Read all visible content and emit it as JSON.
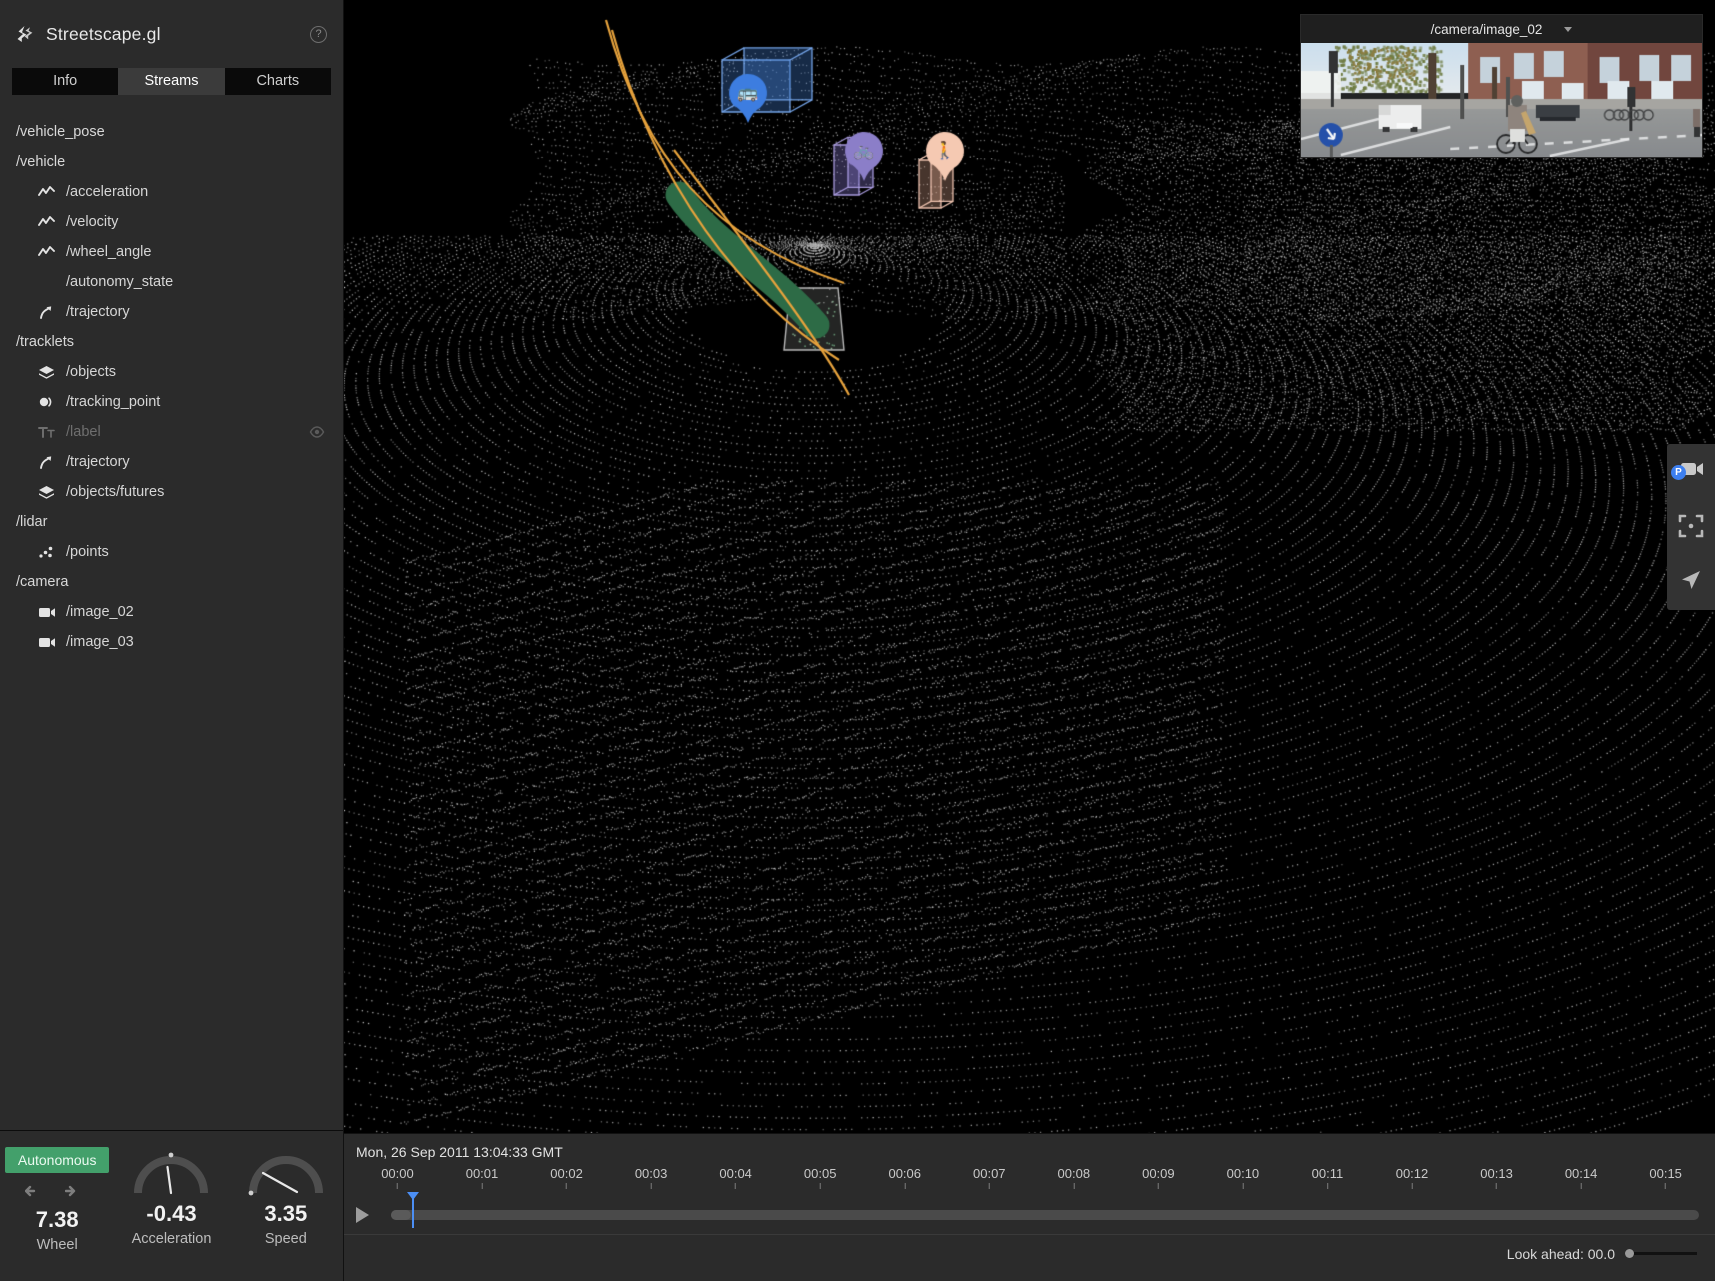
{
  "app": {
    "title": "Streetscape.gl",
    "logo_icon": "streetscape-logo-icon",
    "help_icon": "help-circle-icon"
  },
  "tabs": [
    {
      "label": "Info",
      "active": false
    },
    {
      "label": "Streams",
      "active": true
    },
    {
      "label": "Charts",
      "active": false
    }
  ],
  "streams": [
    {
      "label": "/vehicle_pose",
      "level": "group",
      "icon": null,
      "disabled": false
    },
    {
      "label": "/vehicle",
      "level": "group",
      "icon": null,
      "disabled": false
    },
    {
      "label": "/acceleration",
      "level": "child",
      "icon": "line-chart-icon",
      "disabled": false
    },
    {
      "label": "/velocity",
      "level": "child",
      "icon": "line-chart-icon",
      "disabled": false
    },
    {
      "label": "/wheel_angle",
      "level": "child",
      "icon": "line-chart-icon",
      "disabled": false
    },
    {
      "label": "/autonomy_state",
      "level": "child",
      "icon": null,
      "disabled": false
    },
    {
      "label": "/trajectory",
      "level": "child",
      "icon": "arrow-path-icon",
      "disabled": false
    },
    {
      "label": "/tracklets",
      "level": "group",
      "icon": null,
      "disabled": false
    },
    {
      "label": "/objects",
      "level": "child",
      "icon": "cube-icon",
      "disabled": false
    },
    {
      "label": "/tracking_point",
      "level": "child",
      "icon": "tracking-point-icon",
      "disabled": false
    },
    {
      "label": "/label",
      "level": "child",
      "icon": "text-icon",
      "disabled": true,
      "trailing_icon": "eye-off-icon"
    },
    {
      "label": "/trajectory",
      "level": "child",
      "icon": "arrow-path-icon",
      "disabled": false
    },
    {
      "label": "/objects/futures",
      "level": "child",
      "icon": "cube-icon",
      "disabled": false
    },
    {
      "label": "/lidar",
      "level": "group",
      "icon": null,
      "disabled": false
    },
    {
      "label": "/points",
      "level": "child",
      "icon": "points-icon",
      "disabled": false
    },
    {
      "label": "/camera",
      "level": "group",
      "icon": null,
      "disabled": false
    },
    {
      "label": "/image_02",
      "level": "child",
      "icon": "video-camera-icon",
      "disabled": false
    },
    {
      "label": "/image_03",
      "level": "child",
      "icon": "video-camera-icon",
      "disabled": false
    }
  ],
  "controls": {
    "status_badge": "Autonomous",
    "badge_color": "#43a06b",
    "metrics": [
      {
        "value": "7.38",
        "label": "Wheel",
        "icon": "left-right-arrows-icon"
      },
      {
        "value": "-0.43",
        "label": "Acceleration",
        "icon": "gauge-icon"
      },
      {
        "value": "3.35",
        "label": "Speed",
        "icon": "gauge-icon"
      }
    ]
  },
  "camera_pip": {
    "title": "/camera/image_02",
    "caret_icon": "chevron-down-icon"
  },
  "rail": [
    {
      "name": "camera-perspective-button",
      "icon": "video-camera-icon",
      "badge": "P"
    },
    {
      "name": "recenter-button",
      "icon": "focus-frame-icon",
      "badge": null
    },
    {
      "name": "navigate-button",
      "icon": "navigation-arrow-icon",
      "badge": null
    }
  ],
  "timeline": {
    "date": "Mon, 26 Sep 2011 13:04:33 GMT",
    "play_icon": "play-icon",
    "ticks": [
      "00:00",
      "00:01",
      "00:02",
      "00:03",
      "00:04",
      "00:05",
      "00:06",
      "00:07",
      "00:08",
      "00:09",
      "00:10",
      "00:11",
      "00:12",
      "00:13",
      "00:14",
      "00:15"
    ],
    "playhead_percent": 1.6,
    "look_ahead_label": "Look ahead: 00.0",
    "look_ahead_value": 0
  },
  "scene": {
    "objects": [
      {
        "type": "vehicle",
        "icon": "bus-icon",
        "color": "#4a86d8"
      },
      {
        "type": "bicycle",
        "icon": "bicycle-icon",
        "color": "#8b7ec8"
      },
      {
        "type": "pedestrian",
        "icon": "pedestrian-icon",
        "color": "#f3c6b0"
      }
    ],
    "trajectory_color": "#2d6b46",
    "future_path_color": "#e6a23c",
    "point_cloud_color": "#cfcfcf",
    "background": "#000000"
  }
}
